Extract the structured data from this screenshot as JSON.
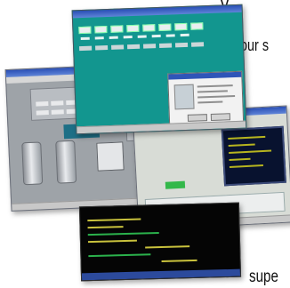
{
  "text_fragments": {
    "top": "y",
    "middle": "four s",
    "bottom": "supe"
  },
  "colors": {
    "teal_window": "#12968f",
    "titlebar_blue": "#2a4fb5",
    "gray_window": "#9ea3a8",
    "dark_window": "#050505",
    "code_yellow": "#c9c23d",
    "code_green": "#2bb24c"
  }
}
